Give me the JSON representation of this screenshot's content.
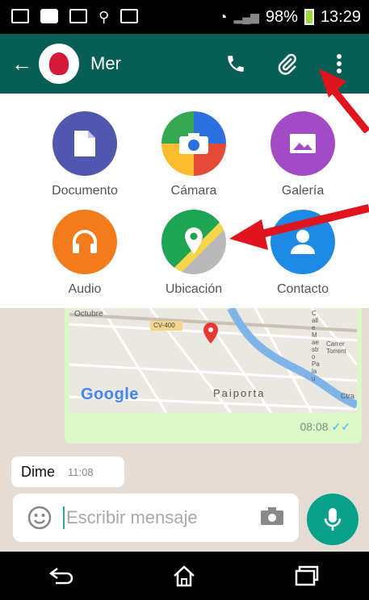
{
  "status_bar": {
    "battery_text": "98%",
    "time": "13:29"
  },
  "app_bar": {
    "contact_name": "Mer"
  },
  "attachments": [
    {
      "label": "Documento",
      "color": "#5157ae",
      "icon": "document-icon"
    },
    {
      "label": "Cámara",
      "color": "#e64a37",
      "icon": "camera-icon"
    },
    {
      "label": "Galería",
      "color": "#a34bc7",
      "icon": "gallery-icon"
    },
    {
      "label": "Audio",
      "color": "#f27c1b",
      "icon": "headphones-icon"
    },
    {
      "label": "Ubicación",
      "color": "#1da553",
      "icon": "location-icon"
    },
    {
      "label": "Contacto",
      "color": "#1e8ae5",
      "icon": "contact-icon"
    }
  ],
  "map_message": {
    "map_labels": [
      "Octubre",
      "CV-400",
      "Google",
      "Paiporta",
      "Carrer Torrent",
      "Calle Maestro Palau",
      "Ctra"
    ],
    "time": "08:08"
  },
  "messages": [
    {
      "text": "Dime",
      "time": "11:08"
    }
  ],
  "composer": {
    "placeholder": "Escribir mensaje"
  },
  "colors": {
    "header": "#075e54",
    "accent": "#0aa18b",
    "outgoing_bubble": "#dcf8c6",
    "annotation_arrow": "#e0141e"
  }
}
